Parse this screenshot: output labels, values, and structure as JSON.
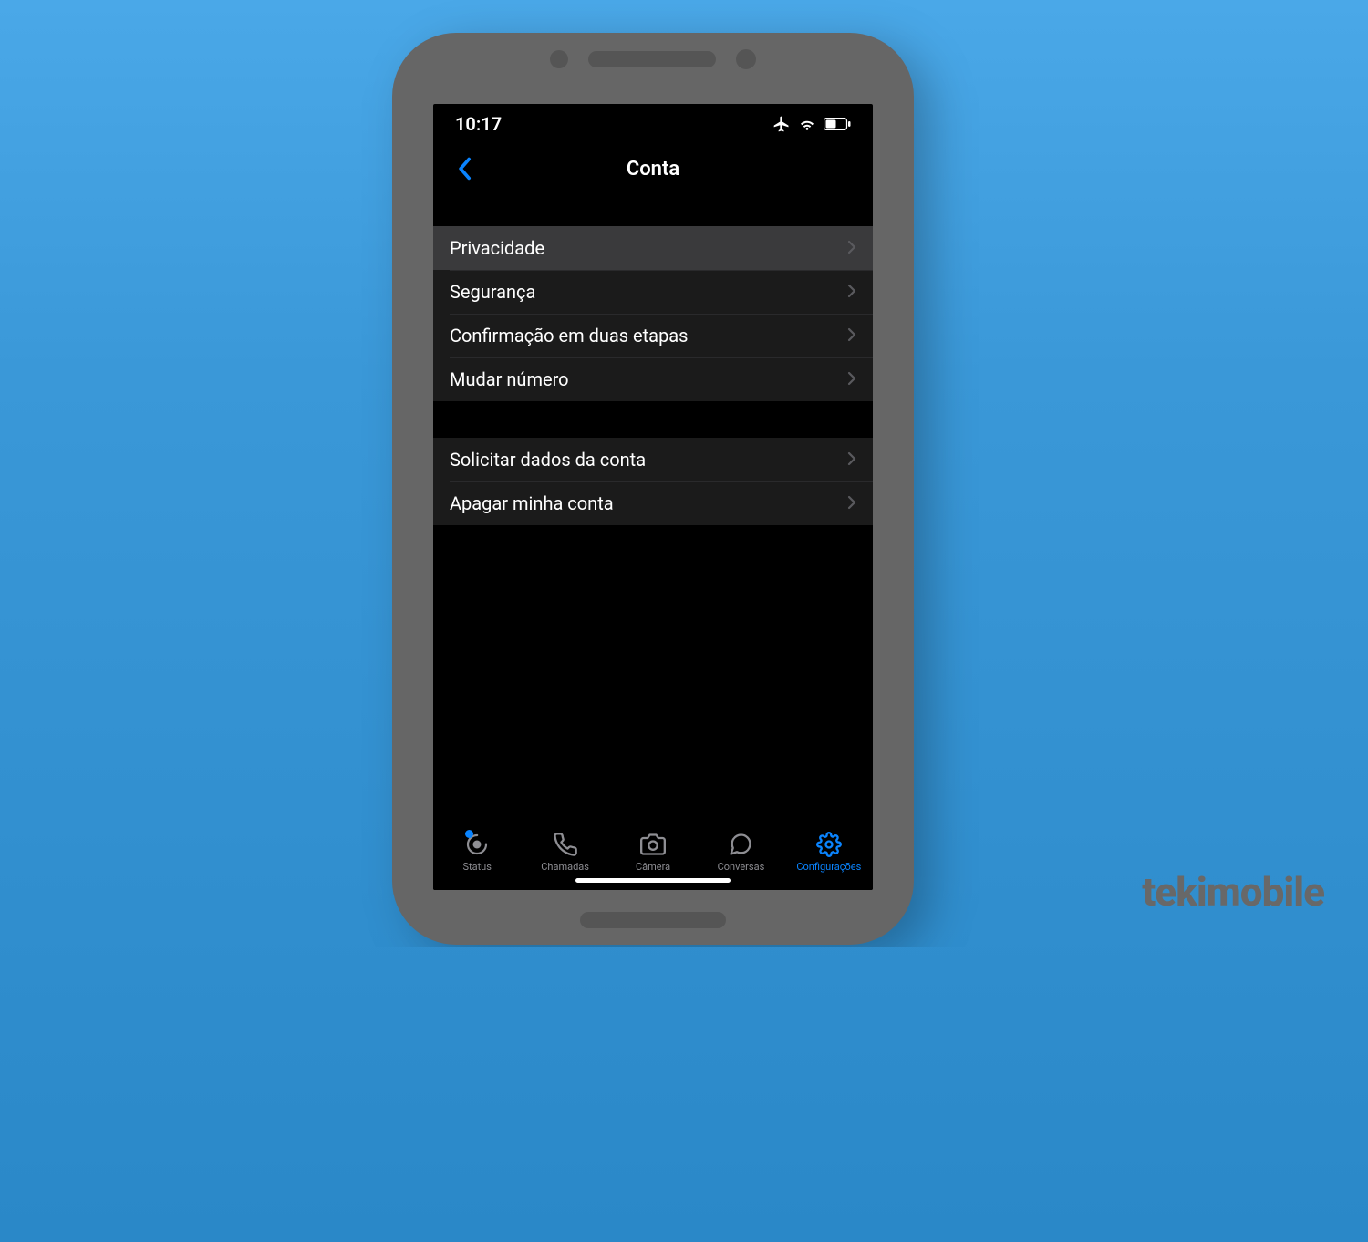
{
  "status_bar": {
    "time": "10:17"
  },
  "nav": {
    "title": "Conta"
  },
  "section1": [
    {
      "label": "Privacidade",
      "highlight": true
    },
    {
      "label": "Segurança",
      "highlight": false
    },
    {
      "label": "Confirmação em duas etapas",
      "highlight": false
    },
    {
      "label": "Mudar número",
      "highlight": false
    }
  ],
  "section2": [
    {
      "label": "Solicitar dados da conta"
    },
    {
      "label": "Apagar minha conta"
    }
  ],
  "tabs": {
    "status": "Status",
    "calls": "Chamadas",
    "camera": "Câmera",
    "chats": "Conversas",
    "settings": "Configurações"
  },
  "brand": "tekimobile"
}
